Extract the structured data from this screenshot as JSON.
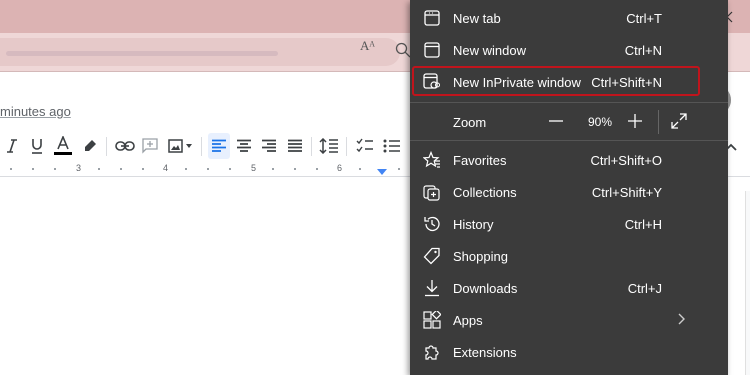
{
  "colors": {
    "titlebar": "#dcb3b3",
    "toolbar": "#efd7d7",
    "menu_bg": "#3b3b3b",
    "menu_text": "#ffffff",
    "highlight_border": "#c0141c",
    "doc_accent": "#4285f4"
  },
  "browser": {
    "more_icon": "ellipsis-icon",
    "read_aloud_label": "Aᴬ"
  },
  "doc": {
    "last_edit": "minutes ago",
    "ruler_numbers": [
      "3",
      "4",
      "5",
      "6"
    ]
  },
  "menu": {
    "items_top": [
      {
        "label": "New tab",
        "shortcut": "Ctrl+T",
        "icon": "new-tab-icon"
      },
      {
        "label": "New window",
        "shortcut": "Ctrl+N",
        "icon": "new-window-icon"
      },
      {
        "label": "New InPrivate window",
        "shortcut": "Ctrl+Shift+N",
        "icon": "inprivate-icon",
        "highlighted": true
      }
    ],
    "zoom": {
      "label": "Zoom",
      "value": "90%",
      "minus": "—",
      "plus": "+"
    },
    "items_bottom": [
      {
        "label": "Favorites",
        "shortcut": "Ctrl+Shift+O",
        "icon": "favorites-icon"
      },
      {
        "label": "Collections",
        "shortcut": "Ctrl+Shift+Y",
        "icon": "collections-icon"
      },
      {
        "label": "History",
        "shortcut": "Ctrl+H",
        "icon": "history-icon"
      },
      {
        "label": "Shopping",
        "shortcut": "",
        "icon": "shopping-tag-icon"
      },
      {
        "label": "Downloads",
        "shortcut": "Ctrl+J",
        "icon": "downloads-icon"
      },
      {
        "label": "Apps",
        "shortcut": "",
        "icon": "apps-icon",
        "submenu": true
      },
      {
        "label": "Extensions",
        "shortcut": "",
        "icon": "extensions-icon"
      }
    ]
  }
}
